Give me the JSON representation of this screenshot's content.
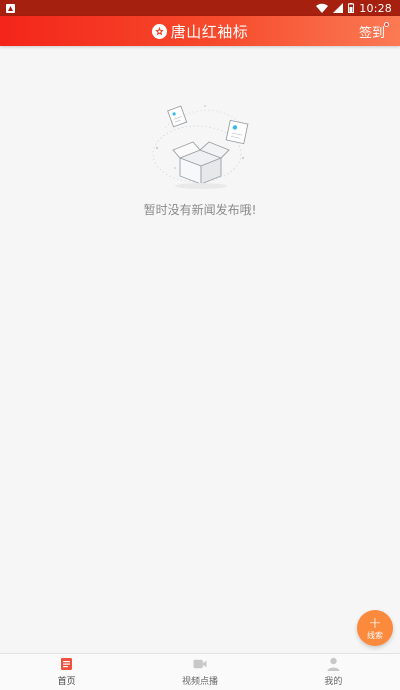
{
  "status_bar": {
    "time": "10:28",
    "icons": [
      "app-notification-icon",
      "wifi-icon",
      "signal-icon",
      "battery-icon"
    ]
  },
  "header": {
    "title": "唐山红袖标",
    "logo_icon": "star-badge-icon",
    "checkin_label": "签到",
    "gradient": [
      "#f4251a",
      "#fb7a54"
    ]
  },
  "empty_state": {
    "illustration_icon": "empty-box-icon",
    "message": "暂时没有新闻发布哦!"
  },
  "fab": {
    "icon": "plus-icon",
    "label": "线索",
    "color": "#fb8a3c"
  },
  "bottom_nav": {
    "items": [
      {
        "label": "首页",
        "icon": "news-icon",
        "active": true
      },
      {
        "label": "视频点播",
        "icon": "video-icon",
        "active": false
      },
      {
        "label": "我的",
        "icon": "user-icon",
        "active": false
      }
    ],
    "active_color": "#f0503c",
    "inactive_color": "#c8c8c8"
  }
}
